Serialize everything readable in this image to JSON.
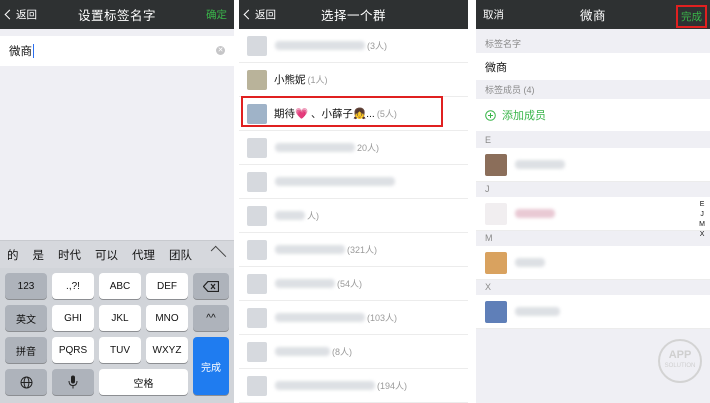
{
  "panel1": {
    "back_label": "返回",
    "title": "设置标签名字",
    "confirm_label": "确定",
    "input_value": "微商",
    "suggestions": [
      "的",
      "是",
      "时代",
      "可以",
      "代理",
      "团队"
    ],
    "keys": {
      "k123": "123",
      "punct": ".,?!",
      "abc": "ABC",
      "def": "DEF",
      "english": "英文",
      "ghi": "GHI",
      "jkl": "JKL",
      "mno": "MNO",
      "emoji": "^^",
      "pinyin": "拼音",
      "pqrs": "PQRS",
      "tuv": "TUV",
      "wxyz": "WXYZ",
      "space": "空格",
      "done": "完成"
    }
  },
  "panel2": {
    "back_label": "返回",
    "title": "选择一个群",
    "groups": [
      {
        "name": "",
        "count": "(3人)"
      },
      {
        "name": "小熊妮",
        "count": "(1人)"
      },
      {
        "name": "期待💗      、小薛子👧...",
        "count": "(5人)"
      },
      {
        "name": "",
        "count": "20人)"
      },
      {
        "name": "",
        "count": "人)"
      },
      {
        "name": "",
        "count": "人)"
      },
      {
        "name": "",
        "count": "(321人)"
      },
      {
        "name": "",
        "count": "(54人)"
      },
      {
        "name": "",
        "count": "(103人)"
      },
      {
        "name": "",
        "count": "(8人)"
      },
      {
        "name": "",
        "count": "(194人)"
      }
    ]
  },
  "panel3": {
    "cancel_label": "取消",
    "title": "微商",
    "done_label": "完成",
    "tag_name_header": "标签名字",
    "tag_name_value": "微商",
    "members_header": "标签成员 (4)",
    "add_member_label": "添加成员",
    "sections": [
      "E",
      "J",
      "M",
      "X"
    ],
    "index_letters": [
      "E",
      "J",
      "M",
      "X"
    ],
    "watermark_main": "APP",
    "watermark_sub": "SOLUTION"
  }
}
